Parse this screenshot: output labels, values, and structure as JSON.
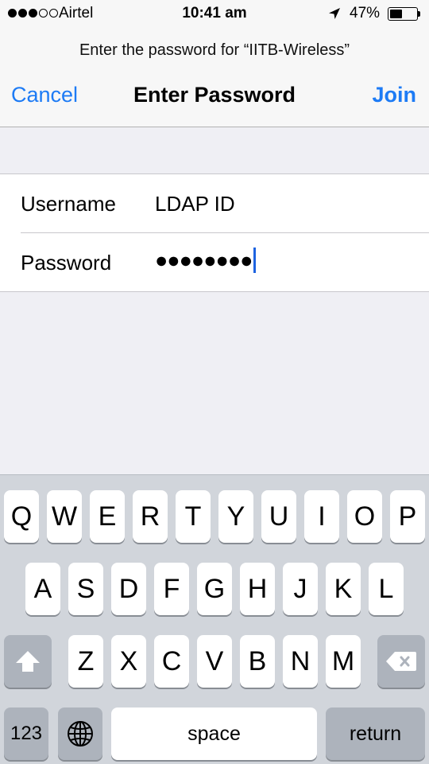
{
  "status_bar": {
    "carrier": "Airtel",
    "signal_bars_filled": 3,
    "signal_bars_total": 5,
    "time": "10:41 am",
    "battery_percent": "47%",
    "icons": [
      "signal-dots-icon",
      "location-arrow-icon",
      "battery-icon"
    ]
  },
  "prompt": "Enter the password for “IITB-Wireless”",
  "nav": {
    "cancel_label": "Cancel",
    "title": "Enter Password",
    "join_label": "Join"
  },
  "form": {
    "username_label": "Username",
    "username_value": "LDAP ID",
    "password_label": "Password",
    "password_value": "●●●●●●●●"
  },
  "keyboard": {
    "row1": [
      "Q",
      "W",
      "E",
      "R",
      "T",
      "Y",
      "U",
      "I",
      "O",
      "P"
    ],
    "row2": [
      "A",
      "S",
      "D",
      "F",
      "G",
      "H",
      "J",
      "K",
      "L"
    ],
    "row3": [
      "Z",
      "X",
      "C",
      "V",
      "B",
      "N",
      "M"
    ],
    "numbers_label": "123",
    "space_label": "space",
    "return_label": "return",
    "icons": [
      "shift-icon",
      "delete-icon",
      "globe-icon"
    ]
  },
  "colors": {
    "accent": "#1d7bf5",
    "background": "#efeff4",
    "keyboard": "#d1d5db"
  }
}
